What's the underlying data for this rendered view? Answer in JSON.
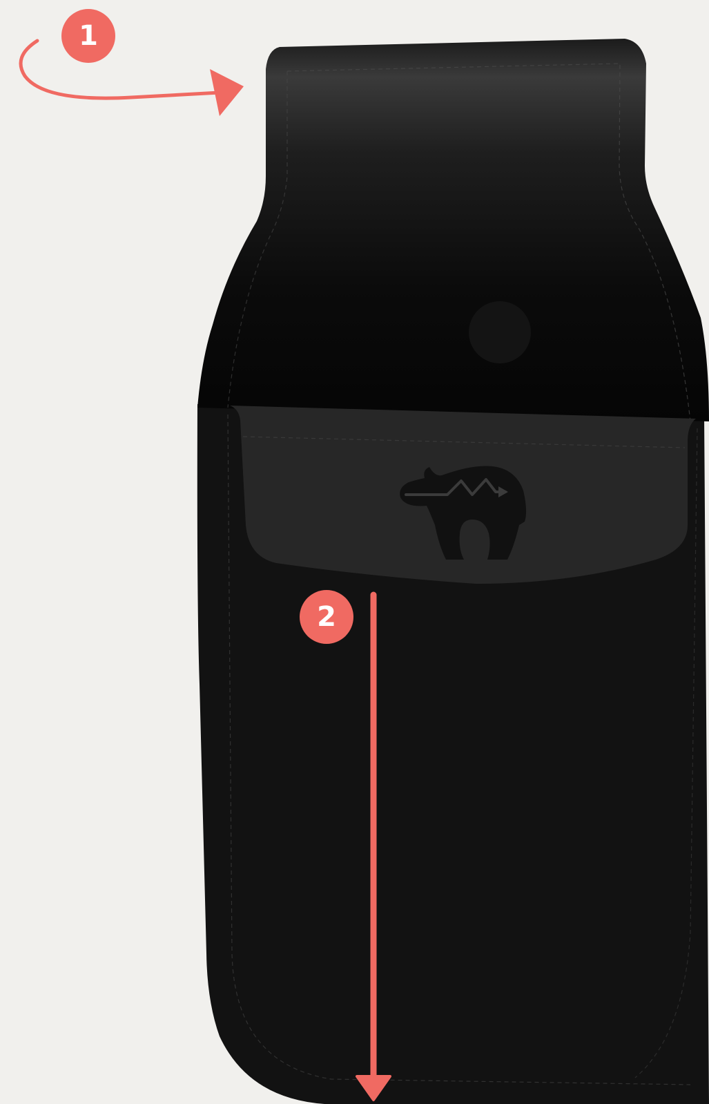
{
  "steps": [
    {
      "number": "1",
      "action": "rotate"
    },
    {
      "number": "2",
      "action": "pull-down"
    }
  ],
  "colors": {
    "background": "#f1f0ed",
    "accent": "#f06a62",
    "holster_body": "#121212",
    "holster_flap_top": "#3a3a3a",
    "holster_flap_bottom": "#050505",
    "pocket_flap": "#272727",
    "logo": "#111111"
  },
  "icons": {
    "rotate_arrow": "curved-arrow-icon",
    "pull_arrow": "down-arrow-icon",
    "logo": "bear-logo-icon"
  }
}
